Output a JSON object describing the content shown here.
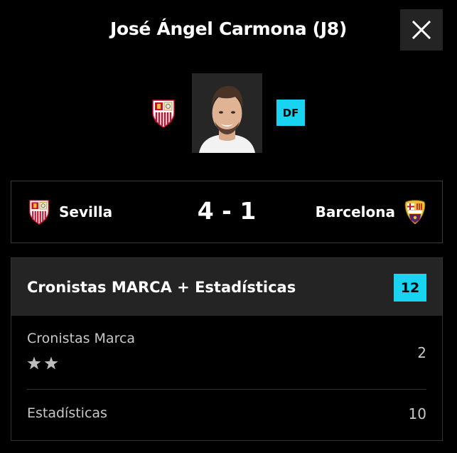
{
  "modal": {
    "title": "José Ángel Carmona (J8)",
    "close_icon": "close-icon"
  },
  "player": {
    "club_crest": "sevilla-crest-icon",
    "photo": "player-photo",
    "position": "DF"
  },
  "match": {
    "home_team": "Sevilla",
    "home_crest": "sevilla-crest-icon",
    "score": "4 - 1",
    "away_team": "Barcelona",
    "away_crest": "barcelona-crest-icon"
  },
  "rating": {
    "title": "Cronistas MARCA + Estadísticas",
    "total": "12",
    "accent_color": "#19d4f0",
    "rows": [
      {
        "label": "Cronistas Marca",
        "value": "2",
        "stars": 2
      },
      {
        "label": "Estadísticas",
        "value": "10"
      }
    ]
  }
}
